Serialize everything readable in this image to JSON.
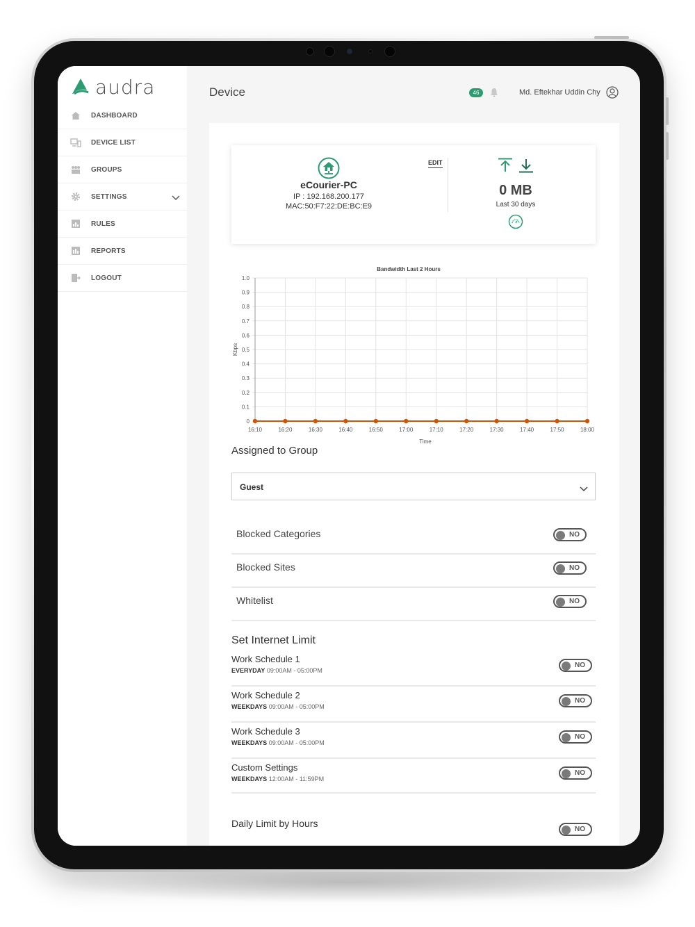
{
  "app": {
    "logo_text": "audra",
    "brand_color": "#2d9b72"
  },
  "sidebar": {
    "items": [
      {
        "label": "DASHBOARD",
        "icon": "home-icon"
      },
      {
        "label": "DEVICE LIST",
        "icon": "devices-icon"
      },
      {
        "label": "GROUPS",
        "icon": "groups-icon"
      },
      {
        "label": "SETTINGS",
        "icon": "gear-icon",
        "expandable": true
      },
      {
        "label": "RULES",
        "icon": "rules-icon"
      },
      {
        "label": "REPORTS",
        "icon": "reports-icon"
      },
      {
        "label": "LOGOUT",
        "icon": "logout-icon"
      }
    ]
  },
  "header": {
    "title": "Device",
    "notification_count": "46",
    "user_name": "Md. Eftekhar Uddin Chy"
  },
  "device": {
    "name": "eCourier-PC",
    "ip": "IP : 192.168.200.177",
    "mac": "MAC:50:F7:22:DE:BC:E9",
    "edit_label": "EDIT",
    "usage_value": "0 MB",
    "usage_label": "Last 30 days"
  },
  "chart_data": {
    "type": "line",
    "title": "Bandwidth Last 2 Hours",
    "xlabel": "Time",
    "ylabel": "Kbps",
    "x": [
      "16:10",
      "16:20",
      "16:30",
      "16:40",
      "16:50",
      "17:00",
      "17:10",
      "17:20",
      "17:30",
      "17:40",
      "17:50",
      "18:00"
    ],
    "series": [
      {
        "values": [
          0,
          0,
          0,
          0,
          0,
          0,
          0,
          0,
          0,
          0,
          0,
          0
        ],
        "color": "#d35400"
      }
    ],
    "ylim": [
      0,
      1.0
    ],
    "yticks": [
      "0",
      "0.1",
      "0.2",
      "0.3",
      "0.4",
      "0.5",
      "0.6",
      "0.7",
      "0.8",
      "0.9",
      "1.0"
    ],
    "grid": true
  },
  "group": {
    "title": "Assigned to Group",
    "selected": "Guest"
  },
  "filters": [
    {
      "label": "Blocked Categories",
      "toggle": "NO"
    },
    {
      "label": "Blocked Sites",
      "toggle": "NO"
    },
    {
      "label": "Whitelist",
      "toggle": "NO"
    }
  ],
  "internet_limit": {
    "title": "Set Internet Limit",
    "schedules": [
      {
        "title": "Work Schedule 1",
        "days": "EVERYDAY",
        "time": "09:00AM - 05:00PM",
        "toggle": "NO"
      },
      {
        "title": "Work Schedule 2",
        "days": "WEEKDAYS",
        "time": "09:00AM - 05:00PM",
        "toggle": "NO"
      },
      {
        "title": "Work Schedule 3",
        "days": "WEEKDAYS",
        "time": "09:00AM - 05:00PM",
        "toggle": "NO"
      },
      {
        "title": "Custom Settings",
        "days": "WEEKDAYS",
        "time": "12:00AM - 11:59PM",
        "toggle": "NO"
      }
    ]
  },
  "daily_limit": {
    "title": "Daily Limit by Hours",
    "toggle": "NO"
  }
}
